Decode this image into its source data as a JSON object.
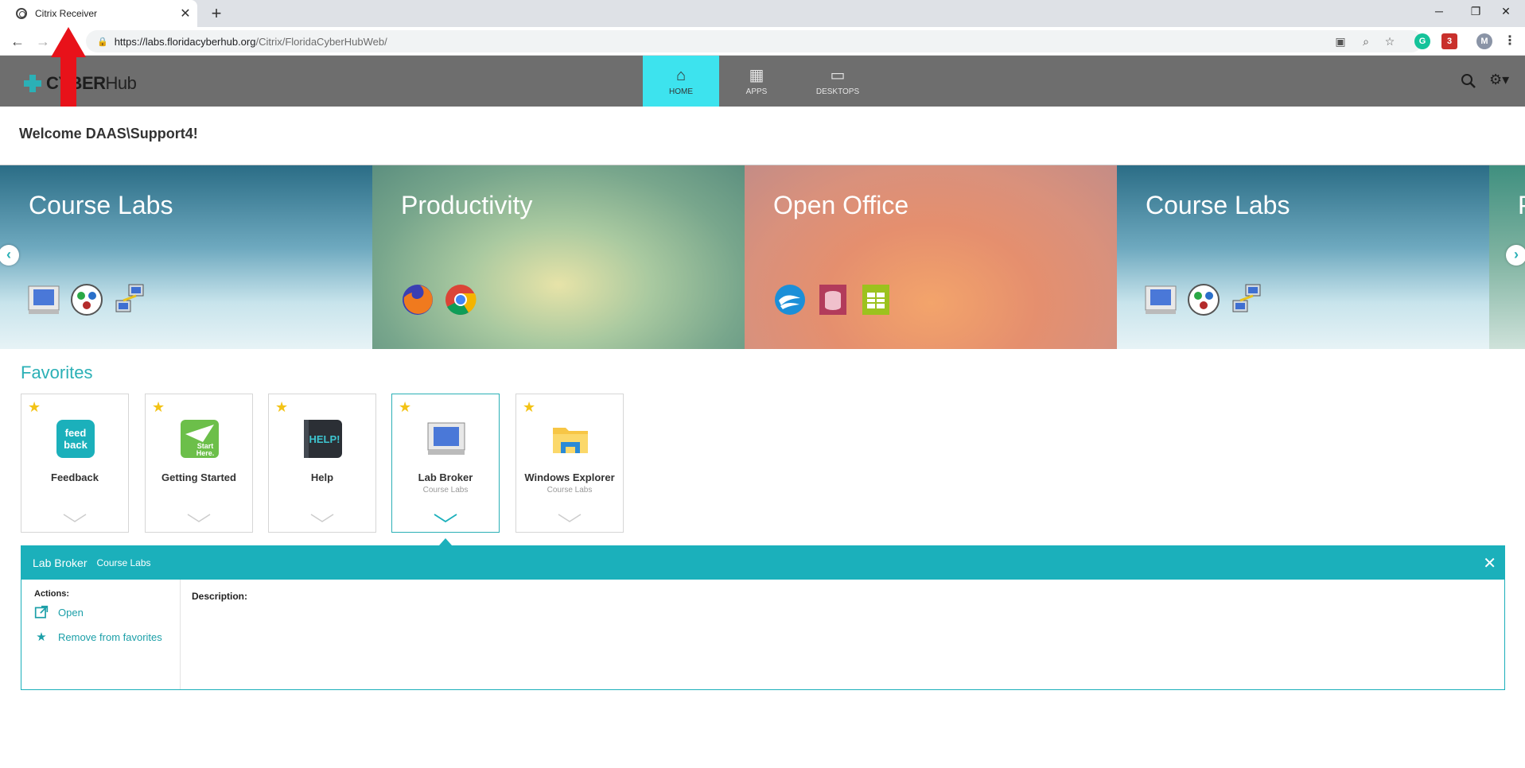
{
  "browser": {
    "tab_title": "Citrix Receiver",
    "tab_close": "✕",
    "new_tab": "+",
    "url_host": "https://labs.floridacyberhub.org",
    "url_path": "/Citrix/FloridaCyberHubWeb/",
    "extension_badge": "3",
    "profile_initial": "M",
    "grammarly_initial": "G"
  },
  "header": {
    "logo_main": "CYBER",
    "logo_suffix": "Hub",
    "nav": [
      {
        "label": "HOME",
        "icon": "home-icon",
        "active": true
      },
      {
        "label": "APPS",
        "icon": "grid-icon",
        "active": false
      },
      {
        "label": "DESKTOPS",
        "icon": "monitor-icon",
        "active": false
      }
    ]
  },
  "welcome": "Welcome DAAS\\Support4!",
  "carousel": {
    "slides": [
      {
        "title": "Course Labs",
        "icons": [
          "monitor-app-icon",
          "three-dots-app-icon",
          "network-app-icon"
        ]
      },
      {
        "title": "Productivity",
        "icons": [
          "firefox-icon",
          "chrome-icon"
        ]
      },
      {
        "title": "Open Office",
        "icons": [
          "openoffice-icon",
          "oo-base-icon",
          "oo-calc-icon"
        ]
      },
      {
        "title": "Course Labs",
        "icons": [
          "monitor-app-icon",
          "three-dots-app-icon",
          "network-app-icon"
        ]
      },
      {
        "title": "P",
        "icons": []
      }
    ]
  },
  "favorites": {
    "title": "Favorites",
    "tiles": [
      {
        "name": "Feedback",
        "sub": "",
        "icon": "feedback-icon",
        "icon_text": "feed•back"
      },
      {
        "name": "Getting Started",
        "sub": "",
        "icon": "start-here-icon",
        "icon_text": "Start Here."
      },
      {
        "name": "Help",
        "sub": "",
        "icon": "help-icon",
        "icon_text": "HELP!"
      },
      {
        "name": "Lab Broker",
        "sub": "Course Labs",
        "icon": "monitor-app-icon",
        "icon_text": ""
      },
      {
        "name": "Windows Explorer",
        "sub": "Course Labs",
        "icon": "folder-icon",
        "icon_text": ""
      }
    ]
  },
  "details": {
    "name": "Lab Broker",
    "category": "Course Labs",
    "actions_label": "Actions:",
    "open": "Open",
    "remove": "Remove from favorites",
    "description_label": "Description:"
  },
  "colors": {
    "accent": "#1bb0bb",
    "active_tab": "#3de3ee",
    "header_bg": "#6e6e6e",
    "star": "#f3c316"
  }
}
